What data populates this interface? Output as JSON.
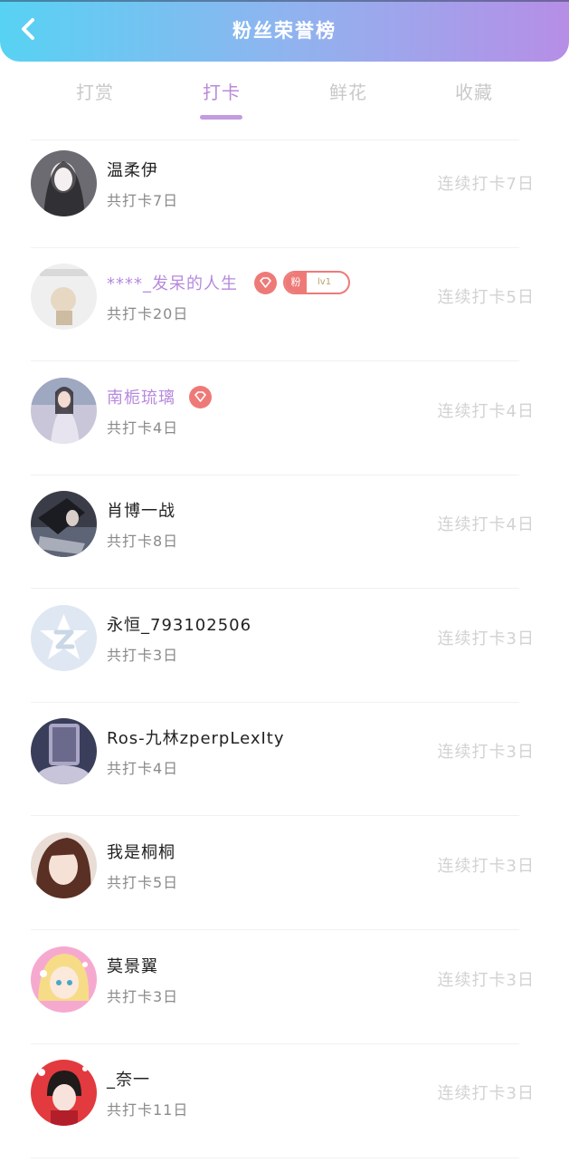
{
  "header": {
    "title": "粉丝荣誉榜",
    "back_icon": "chevron-left-icon"
  },
  "tabs": [
    {
      "label": "打赏",
      "active": false
    },
    {
      "label": "打卡",
      "active": true
    },
    {
      "label": "鲜花",
      "active": false
    },
    {
      "label": "收藏",
      "active": false
    }
  ],
  "colors": {
    "accent": "#b98ad8",
    "badge": "#ee7a78",
    "header_start": "#57d2f3",
    "header_end": "#b68ee6"
  },
  "rows": [
    {
      "name": "温柔伊",
      "vip": false,
      "total": "共打卡7日",
      "streak": "连续打卡7日"
    },
    {
      "name": "****_发呆的人生",
      "vip": true,
      "gem_icon": "diamond-icon",
      "fan_badge_label": "粉",
      "fan_badge_level": "lv1",
      "total": "共打卡20日",
      "streak": "连续打卡5日"
    },
    {
      "name": "南栀琉璃",
      "vip": true,
      "gem_icon": "diamond-icon",
      "total": "共打卡4日",
      "streak": "连续打卡4日"
    },
    {
      "name": "肖博一战",
      "vip": false,
      "total": "共打卡8日",
      "streak": "连续打卡4日"
    },
    {
      "name": "永恒_793102506",
      "vip": false,
      "total": "共打卡3日",
      "streak": "连续打卡3日"
    },
    {
      "name": "Ros-九林zperpLexIty",
      "vip": false,
      "total": "共打卡4日",
      "streak": "连续打卡3日"
    },
    {
      "name": "我是桐桐",
      "vip": false,
      "total": "共打卡5日",
      "streak": "连续打卡3日"
    },
    {
      "name": "莫景翼",
      "vip": false,
      "total": "共打卡3日",
      "streak": "连续打卡3日"
    },
    {
      "name": "_奈一",
      "vip": false,
      "total": "共打卡11日",
      "streak": "连续打卡3日"
    }
  ]
}
